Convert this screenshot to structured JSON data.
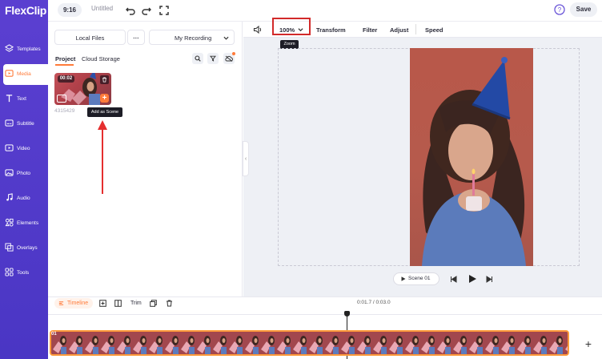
{
  "app": {
    "logo": "FlexClip"
  },
  "topbar": {
    "ratio": "9:16",
    "title": "Untitled",
    "save_label": "Save"
  },
  "sidebar": {
    "items": [
      {
        "label": "Templates",
        "icon": "templates-icon"
      },
      {
        "label": "Media",
        "icon": "media-icon",
        "active": true
      },
      {
        "label": "Text",
        "icon": "text-icon"
      },
      {
        "label": "Subtitle",
        "icon": "subtitle-icon"
      },
      {
        "label": "Video",
        "icon": "video-icon"
      },
      {
        "label": "Photo",
        "icon": "photo-icon"
      },
      {
        "label": "Audio",
        "icon": "audio-icon"
      },
      {
        "label": "Elements",
        "icon": "elements-icon"
      },
      {
        "label": "Overlays",
        "icon": "overlays-icon"
      },
      {
        "label": "Tools",
        "icon": "tools-icon"
      }
    ]
  },
  "media_panel": {
    "local_files": "Local Files",
    "more": "···",
    "my_recording": "My Recording",
    "tabs": {
      "project": "Project",
      "cloud_storage": "Cloud Storage"
    },
    "thumbnail": {
      "duration": "00:02",
      "id": "4315429"
    },
    "tooltip_add_scene": "Add as Scene"
  },
  "editor_toolbar": {
    "zoom_value": "100%",
    "zoom_tooltip": "Zoom",
    "transform": "Transform",
    "filter": "Filter",
    "adjust": "Adjust",
    "speed": "Speed"
  },
  "player": {
    "scene_label": "Scene 01"
  },
  "timeline": {
    "label": "Timeline",
    "trim": "Trim",
    "time": "0:01.7 / 0:03.0",
    "clip_number": "01",
    "add": "+"
  },
  "colors": {
    "brand": "#5a3fd0",
    "accent": "#ff7b3a",
    "highlight": "#d22a2a"
  }
}
